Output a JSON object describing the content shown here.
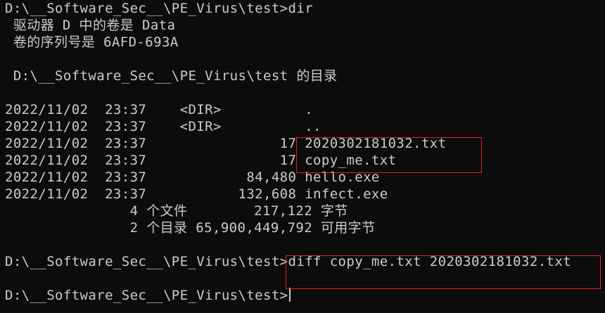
{
  "terminal": {
    "lines": [
      {
        "id": "prompt-dir",
        "text": "D:\\__Software_Sec__\\PE_Virus\\test>dir"
      },
      {
        "id": "volume-label",
        "text": " 驱动器 D 中的卷是 Data"
      },
      {
        "id": "volume-serial",
        "text": " 卷的序列号是 6AFD-693A"
      },
      {
        "id": "blank-1",
        "text": ""
      },
      {
        "id": "dir-header",
        "text": " D:\\__Software_Sec__\\PE_Virus\\test 的目录"
      },
      {
        "id": "blank-2",
        "text": ""
      },
      {
        "id": "entry-dot",
        "text": "2022/11/02  23:37    <DIR>          ."
      },
      {
        "id": "entry-dotdot",
        "text": "2022/11/02  23:37    <DIR>          .."
      },
      {
        "id": "entry-2020302181032",
        "text": "2022/11/02  23:37                17 2020302181032.txt"
      },
      {
        "id": "entry-copy-me",
        "text": "2022/11/02  23:37                17 copy_me.txt"
      },
      {
        "id": "entry-hello",
        "text": "2022/11/02  23:37            84,480 hello.exe"
      },
      {
        "id": "entry-infect",
        "text": "2022/11/02  23:37           132,608 infect.exe"
      },
      {
        "id": "summary-files",
        "text": "               4 个文件        217,122 字节"
      },
      {
        "id": "summary-dirs",
        "text": "               2 个目录 65,900,449,792 可用字节"
      },
      {
        "id": "blank-3",
        "text": ""
      },
      {
        "id": "prompt-diff",
        "text": "D:\\__Software_Sec__\\PE_Virus\\test>diff copy_me.txt 2020302181032.txt"
      },
      {
        "id": "blank-4",
        "text": ""
      },
      {
        "id": "prompt-current",
        "text": "D:\\__Software_Sec__\\PE_Virus\\test>"
      }
    ]
  },
  "colors": {
    "background": "#0c0c0c",
    "foreground": "#cccccc",
    "highlight": "#e02424"
  }
}
